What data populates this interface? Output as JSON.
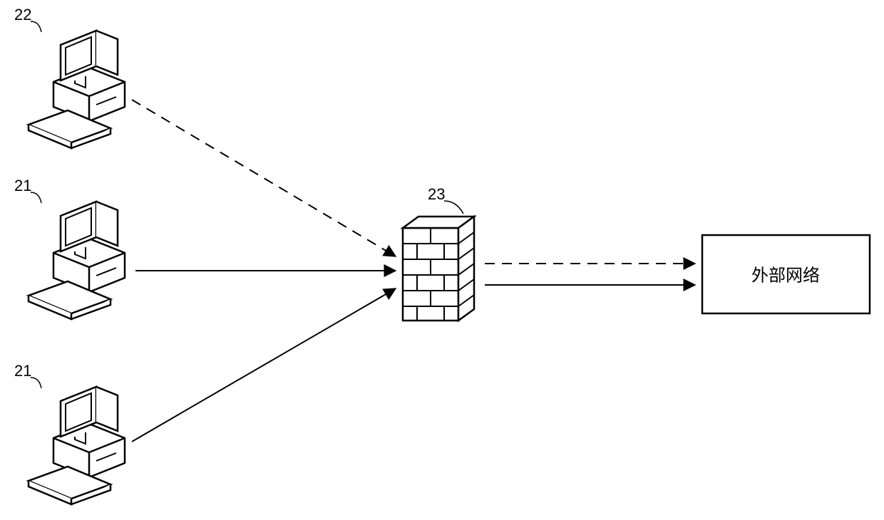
{
  "labels": {
    "computer22": "22",
    "computer21a": "21",
    "computer21b": "21",
    "firewall": "23",
    "externalNetwork": "外部网络"
  }
}
